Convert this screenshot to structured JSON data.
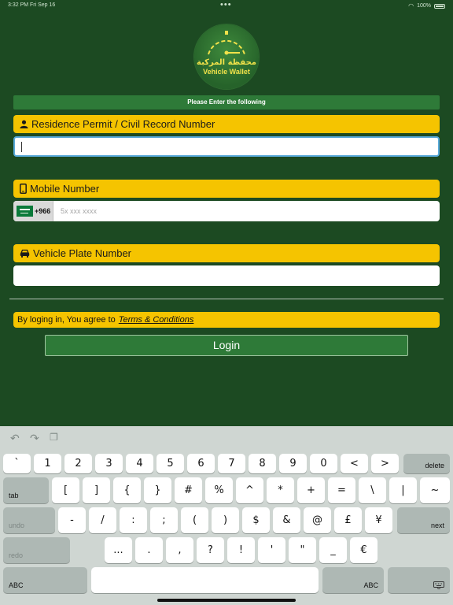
{
  "status_bar": {
    "time": "3:32 PM   Fri Sep 16",
    "battery": "100%"
  },
  "logo": {
    "arabic": "محفظة المركبة",
    "name": "Vehicle Wallet"
  },
  "form": {
    "header": "Please Enter the following",
    "residence_label": "Residence Permit / Civil Record Number",
    "residence_value": "",
    "mobile_label": "Mobile Number",
    "country_code": "+966",
    "mobile_placeholder": "5x xxx xxxx",
    "plate_label": "Vehicle Plate Number",
    "plate_value": ""
  },
  "terms": {
    "prefix": "By loging in, You agree to",
    "link": "Terms & Conditions"
  },
  "login_button": "Login",
  "colors": {
    "background": "#1c4a22",
    "accent_green": "#2e7a38",
    "label_yellow": "#f5c400"
  },
  "keyboard": {
    "toolbar_icons": [
      "undo-icon",
      "redo-icon",
      "paste-icon"
    ],
    "rows": [
      [
        "`",
        "1",
        "2",
        "3",
        "4",
        "5",
        "6",
        "7",
        "8",
        "9",
        "0",
        "<",
        ">",
        "delete"
      ],
      [
        "tab",
        "[",
        "]",
        "{",
        "}",
        "#",
        "%",
        "^",
        "*",
        "+",
        "=",
        "\\",
        "|",
        "~"
      ],
      [
        "undo",
        "-",
        "/",
        ":",
        ";",
        "(",
        ")",
        "$",
        "&",
        "@",
        "£",
        "¥",
        "next"
      ],
      [
        "redo",
        "...",
        ".",
        ",",
        "?",
        "!",
        "'",
        "\"",
        "_",
        "€"
      ],
      [
        "ABC",
        "",
        "ABC",
        "keyboard-hide-icon"
      ]
    ]
  }
}
